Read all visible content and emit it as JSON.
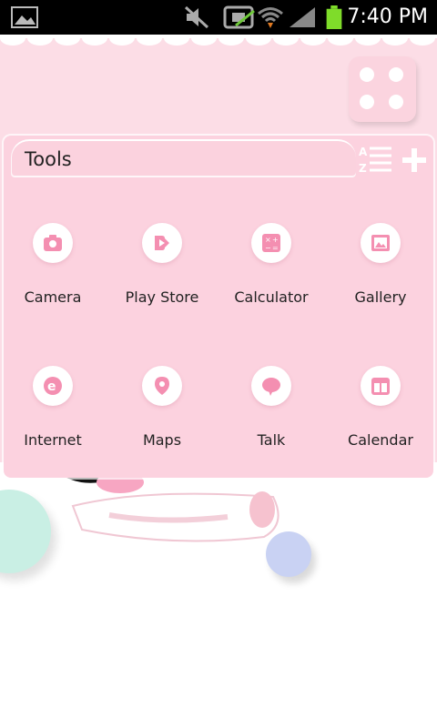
{
  "status_bar": {
    "time": "7:40 PM",
    "icons": [
      "gallery-notification-icon",
      "mute-icon",
      "no-sim-icon",
      "wifi-icon",
      "signal-icon",
      "battery-icon"
    ],
    "battery_color": "#7fdc2a"
  },
  "folder": {
    "name": "Tools",
    "apps": [
      {
        "label": "Camera",
        "icon": "camera-icon"
      },
      {
        "label": "Play Store",
        "icon": "play-store-icon"
      },
      {
        "label": "Calculator",
        "icon": "calculator-icon"
      },
      {
        "label": "Gallery",
        "icon": "gallery-icon"
      },
      {
        "label": "Internet",
        "icon": "internet-icon"
      },
      {
        "label": "Maps",
        "icon": "maps-icon"
      },
      {
        "label": "Talk",
        "icon": "talk-icon"
      },
      {
        "label": "Calendar",
        "icon": "calendar-icon"
      }
    ]
  },
  "colors": {
    "accent_pink": "#f48fb1",
    "panel_pink": "#fcd2df",
    "wall_pink": "#fcdde6"
  }
}
